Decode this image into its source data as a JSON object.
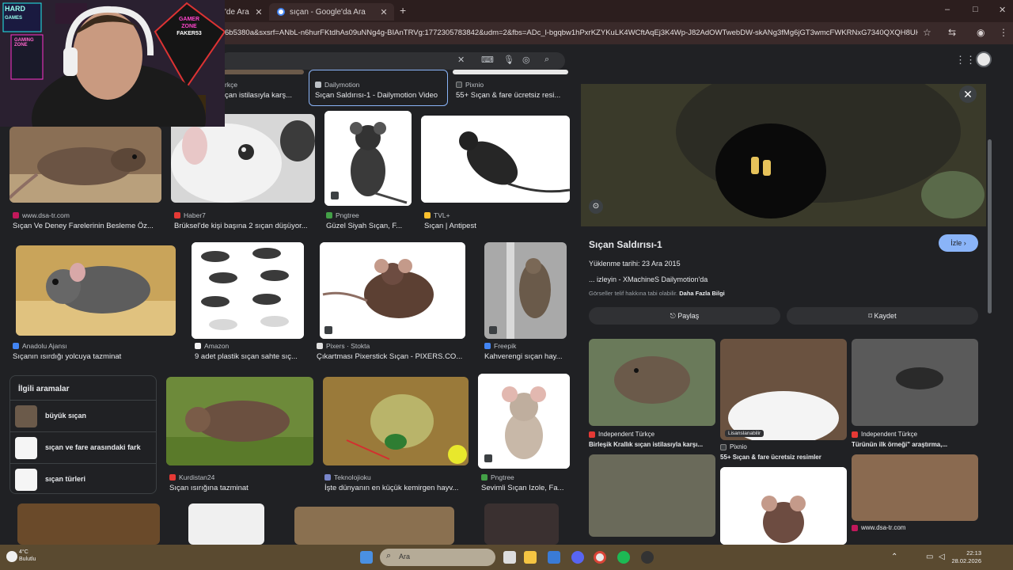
{
  "browser": {
    "tabs": [
      {
        "label": "'de Ara"
      },
      {
        "label": "sıçan - Google'da Ara"
      }
    ],
    "new_tab": "+",
    "window_controls": [
      "–",
      "□",
      "✕"
    ],
    "url": "6b5380a&sxsrf=ANbL-n6hurFKtdhAs09uNNg4g-BIAnTRVg:1772305783842&udm=2&fbs=ADc_l-bgqbw1hPxrKZYKuLK4WCftAqEj3K4Wp-J82AdOWTwebDW-skANg3fMg6jGT3wmcFWKRNxG7340QXQH8UH8US..."
  },
  "search": {
    "clear": "✕"
  },
  "results": [
    {
      "source": "rkçe",
      "caption": "çan istilasıyla karş...",
      "src_color": "#e53935"
    },
    {
      "source": "Dailymotion",
      "caption": "Sıçan Saldırısı-1 - Dailymotion Video",
      "src_color": "#bdc1c6"
    },
    {
      "source": "Pixnio",
      "caption": "55+ Sıçan & fare ücretsiz resi...",
      "src_color": "#3c4043"
    },
    {
      "source": "www.dsa-tr.com",
      "caption": "Sıçan Ve Deney Farelerinin Besleme Öz...",
      "src_color": "#c2185b"
    },
    {
      "source": "Haber7",
      "caption": "Brüksel'de kişi başına 2 sıçan düşüyor...",
      "src_color": "#e53935"
    },
    {
      "source": "Pngtree",
      "caption": "Güzel Siyah Sıçan, F...",
      "src_color": "#43a047"
    },
    {
      "source": "TVL+",
      "caption": "Sıçan | Antipest",
      "src_color": "#fbc02d"
    },
    {
      "source": "Anadolu Ajansı",
      "caption": "Sıçanın ısırdığı yolcuya tazminat",
      "src_color": "#4285f4"
    },
    {
      "source": "Amazon",
      "caption": "9 adet plastik sıçan sahte sıç...",
      "src_color": "#f5f5f5"
    },
    {
      "source": "Pixers · Stokta",
      "caption": "Çıkartması Pixerstick Sıçan - PIXERS.CO...",
      "src_color": "#e0e0e0"
    },
    {
      "source": "Freepik",
      "caption": "Kahverengi sıçan hay...",
      "src_color": "#4285f4"
    },
    {
      "source": "Kurdistan24",
      "caption": "Sıçan ısırığına tazminat",
      "src_color": "#e53935"
    },
    {
      "source": "Teknolojioku",
      "caption": "İşte dünyanın en küçük kemirgen hayv...",
      "src_color": "#7986cb"
    },
    {
      "source": "Pngtree",
      "caption": "Sevimli Sıçan Izole, Fa...",
      "src_color": "#43a047"
    }
  ],
  "related": {
    "title": "İlgili aramalar",
    "items": [
      {
        "label": "büyük sıçan"
      },
      {
        "label": "sıçan ve fare arasındaki fark"
      },
      {
        "label": "sıçan türleri"
      }
    ]
  },
  "panel": {
    "title": "Sıçan Saldırısı-1",
    "watch_label": "İzle ›",
    "upload_date": "Yüklenme tarihi: 23 Ara 2015",
    "watch_info": "... izleyin - XMachineS Dailymotion'da",
    "copyright_note": "Görseller telif hakkına tabi olabilir.",
    "more_info": "Daha Fazla Bilgi",
    "share_label": "Paylaş",
    "save_label": "Kaydet",
    "related": [
      {
        "source": "Independent Türkçe",
        "caption": "Birleşik Krallık sıçan istilasıyla karşı...",
        "src_color": "#e53935"
      },
      {
        "source": "Pixnio",
        "caption": "55+ Sıçan & fare ücretsiz resimler",
        "src_color": "#3c4043",
        "badge": "Lisanslanabilir"
      },
      {
        "source": "Independent Türkçe",
        "caption": "Türünün ilk örneği\" araştırma,...",
        "src_color": "#e53935"
      },
      {
        "source": "www.dsa-tr.com",
        "caption": "",
        "src_color": "#c2185b"
      }
    ]
  },
  "webcam": {
    "sign_lines": [
      "GAMER",
      "ZONE",
      "FAKER53"
    ],
    "wall_labels": [
      "HARD",
      "GAMES",
      "GAMING",
      "ZONE"
    ]
  },
  "taskbar": {
    "weather_temp": "4°C",
    "weather_desc": "Bulutlu",
    "search_label": "Ara",
    "clock_time": "22:13",
    "clock_date": "28.02.2026"
  },
  "colors": {
    "accent": "#8ab4f8",
    "tab_bg": "#2c1e1e",
    "page_bg": "#202124"
  }
}
